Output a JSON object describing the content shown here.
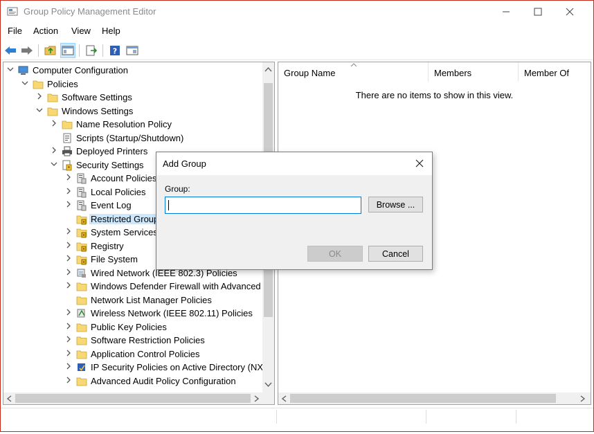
{
  "window": {
    "title": "Group Policy Management Editor",
    "border_color": "#c42b1c"
  },
  "menu": [
    "File",
    "Action",
    "View",
    "Help"
  ],
  "toolbar": {
    "buttons": [
      "back-icon",
      "forward-icon",
      "up-folder-icon",
      "show-hide-tree-icon",
      "export-list-icon",
      "help-icon",
      "properties-pane-icon"
    ]
  },
  "tree": {
    "items": [
      {
        "label": "Computer Configuration",
        "icon": "computer-icon",
        "expander": "expanded",
        "indent": 0
      },
      {
        "label": "Policies",
        "icon": "folder-icon",
        "expander": "expanded",
        "indent": 1
      },
      {
        "label": "Software Settings",
        "icon": "folder-icon",
        "expander": "collapsed",
        "indent": 2
      },
      {
        "label": "Windows Settings",
        "icon": "folder-icon",
        "expander": "expanded",
        "indent": 2
      },
      {
        "label": "Name Resolution Policy",
        "icon": "folder-icon",
        "expander": "collapsed",
        "indent": 3
      },
      {
        "label": "Scripts (Startup/Shutdown)",
        "icon": "script-icon",
        "expander": "none",
        "indent": 3
      },
      {
        "label": "Deployed Printers",
        "icon": "printer-icon",
        "expander": "collapsed",
        "indent": 3
      },
      {
        "label": "Security Settings",
        "icon": "security-settings-icon",
        "expander": "expanded",
        "indent": 3
      },
      {
        "label": "Account Policies",
        "icon": "policy-book-icon",
        "expander": "collapsed",
        "indent": 4
      },
      {
        "label": "Local Policies",
        "icon": "policy-book-icon",
        "expander": "collapsed",
        "indent": 4
      },
      {
        "label": "Event Log",
        "icon": "policy-book-icon",
        "expander": "collapsed",
        "indent": 4
      },
      {
        "label": "Restricted Groups",
        "icon": "locked-folder-icon",
        "expander": "none",
        "indent": 4,
        "selected": true
      },
      {
        "label": "System Services",
        "icon": "locked-folder-icon",
        "expander": "collapsed",
        "indent": 4
      },
      {
        "label": "Registry",
        "icon": "locked-folder-icon",
        "expander": "collapsed",
        "indent": 4
      },
      {
        "label": "File System",
        "icon": "locked-folder-icon",
        "expander": "collapsed",
        "indent": 4
      },
      {
        "label": "Wired Network (IEEE 802.3) Policies",
        "icon": "network-policy-icon",
        "expander": "collapsed",
        "indent": 4
      },
      {
        "label": "Windows Defender Firewall with Advanced",
        "icon": "folder-icon",
        "expander": "collapsed",
        "indent": 4
      },
      {
        "label": "Network List Manager Policies",
        "icon": "folder-icon",
        "expander": "none",
        "indent": 4
      },
      {
        "label": "Wireless Network (IEEE 802.11) Policies",
        "icon": "wireless-policy-icon",
        "expander": "collapsed",
        "indent": 4
      },
      {
        "label": "Public Key Policies",
        "icon": "folder-icon",
        "expander": "collapsed",
        "indent": 4
      },
      {
        "label": "Software Restriction Policies",
        "icon": "folder-icon",
        "expander": "collapsed",
        "indent": 4
      },
      {
        "label": "Application Control Policies",
        "icon": "folder-icon",
        "expander": "collapsed",
        "indent": 4
      },
      {
        "label": "IP Security Policies on Active Directory (NX.",
        "icon": "ip-security-icon",
        "expander": "collapsed",
        "indent": 4
      },
      {
        "label": "Advanced Audit Policy Configuration",
        "icon": "folder-icon",
        "expander": "collapsed",
        "indent": 4
      }
    ]
  },
  "list": {
    "columns": [
      "Group Name",
      "Members",
      "Member Of"
    ],
    "empty_message": "There are no items to show in this view."
  },
  "dialog": {
    "title": "Add Group",
    "group_label": "Group:",
    "group_value": "",
    "browse_label": "Browse ...",
    "ok_label": "OK",
    "cancel_label": "Cancel"
  },
  "colors": {
    "selection": "#cce8ff",
    "input_focus": "#0078d7",
    "folder": "#f8d775"
  }
}
